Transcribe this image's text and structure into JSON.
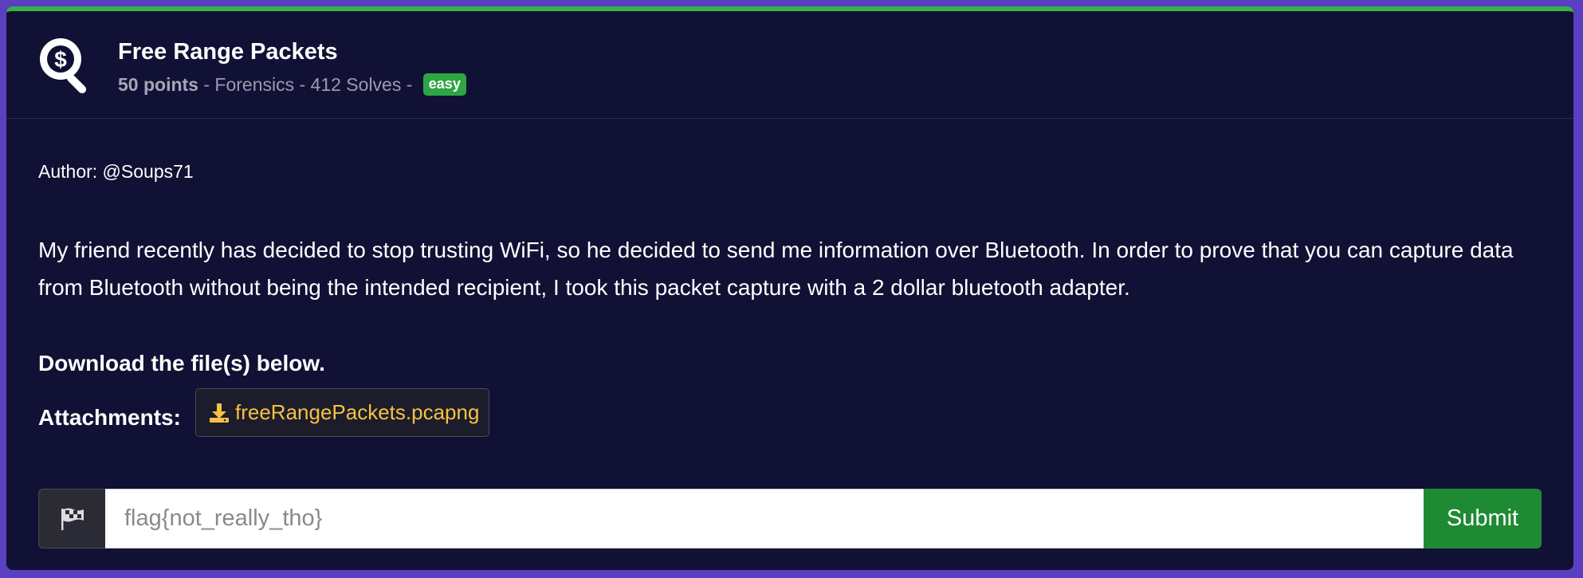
{
  "challenge": {
    "title": "Free Range Packets",
    "points": "50 points",
    "meta_rest": " - Forensics - 412 Solves - ",
    "difficulty": "easy"
  },
  "body": {
    "author": "Author: @Soups71",
    "description": "My friend recently has decided to stop trusting WiFi, so he decided to send me information over Bluetooth. In order to prove that you can capture data from Bluetooth without being the intended recipient, I took this packet capture with a 2 dollar bluetooth adapter.",
    "download_heading": "Download the file(s) below.",
    "attachments_label": "Attachments:",
    "attachment_name": "freeRangePackets.pcapng"
  },
  "flag_form": {
    "placeholder": "flag{not_really_tho}",
    "submit_label": "Submit"
  },
  "colors": {
    "accent_green": "#35b34a",
    "card_bg": "#111135",
    "attachment_text": "#f5c242",
    "submit_bg": "#1f8a34"
  },
  "icons": {
    "header": "dollar-magnifier-icon",
    "download": "download-icon",
    "flag": "checkered-flag-icon"
  }
}
